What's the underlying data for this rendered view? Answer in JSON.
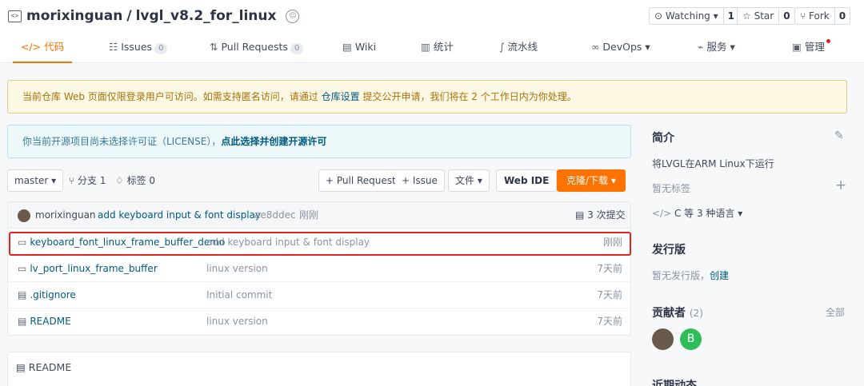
{
  "repo": {
    "owner": "morixinguan",
    "separator": "/",
    "name": "lvgl_v8.2_for_linux",
    "icon": "code-icon",
    "badge_icon": "certificate-icon"
  },
  "social": {
    "watching_label": "⊙ Watching ▾",
    "watching_count": "1",
    "star_label": "☆ Star",
    "star_count": "0",
    "fork_label": "⑂ Fork",
    "fork_count": "0"
  },
  "tabs": [
    {
      "icon": "</>",
      "label": "代码",
      "active": true
    },
    {
      "icon": "☷",
      "label": "Issues",
      "count": "0"
    },
    {
      "icon": "⇅",
      "label": "Pull Requests",
      "count": "0"
    },
    {
      "icon": "▤",
      "label": "Wiki"
    },
    {
      "icon": "▥",
      "label": "统计"
    },
    {
      "icon": "∫",
      "label": "流水线"
    },
    {
      "icon": "∞",
      "label": "DevOps ▾"
    },
    {
      "icon": "⌁",
      "label": "服务 ▾"
    },
    {
      "icon": "▣",
      "label": "管理"
    }
  ],
  "notice": {
    "text_before": "当前仓库 Web 页面仅限登录用户可访问。如需支持匿名访问，请通过 ",
    "link": "仓库设置",
    "text_after": " 提交公开申请，我们将在 2 个工作日内为你处理。"
  },
  "license": {
    "text": "你当前开源项目尚未选择许可证（LICENSE），",
    "link": "点此选择并创建开源许可"
  },
  "toolbar": {
    "branch": "master ▾",
    "branches": "分支 1",
    "tags": "标签 0",
    "pull_request": "+ Pull Request",
    "issue": "+ Issue",
    "files": "文件 ▾",
    "web_ide": "Web IDE",
    "clone": "克隆/下载 ▾"
  },
  "last_commit": {
    "author": "morixinguan",
    "message": "add keyboard input & font display",
    "hash": "ae8ddec",
    "time": "刚刚",
    "commits": "3 次提交"
  },
  "files": [
    {
      "type": "folder",
      "name": "keyboard_font_linux_frame_buffer_demo",
      "message": "add keyboard input & font display",
      "time": "刚刚"
    },
    {
      "type": "folder",
      "name": "lv_port_linux_frame_buffer",
      "message": "linux version",
      "time": "7天前"
    },
    {
      "type": "file",
      "name": ".gitignore",
      "message": "Initial commit",
      "time": "7天前"
    },
    {
      "type": "file",
      "name": "README",
      "message": "linux version",
      "time": "7天前"
    }
  ],
  "readme": {
    "title": "README"
  },
  "sidebar": {
    "intro_title": "简介",
    "intro_text": "将LVGL在ARM Linux下运行",
    "no_tags": "暂无标签",
    "languages": "C 等 3 种语言 ▾",
    "release_title": "发行版",
    "release_text": "暂无发行版，",
    "release_link": "创建",
    "contributors_title": "贡献者",
    "contributors_count": "(2)",
    "contributors_all": "全部",
    "contributor_initial": "B",
    "recent_title": "近期动态"
  },
  "colors": {
    "accent": "#fe7300",
    "link": "#005980",
    "highlight": "#e4231a",
    "contributor_green": "#2ebd59"
  }
}
